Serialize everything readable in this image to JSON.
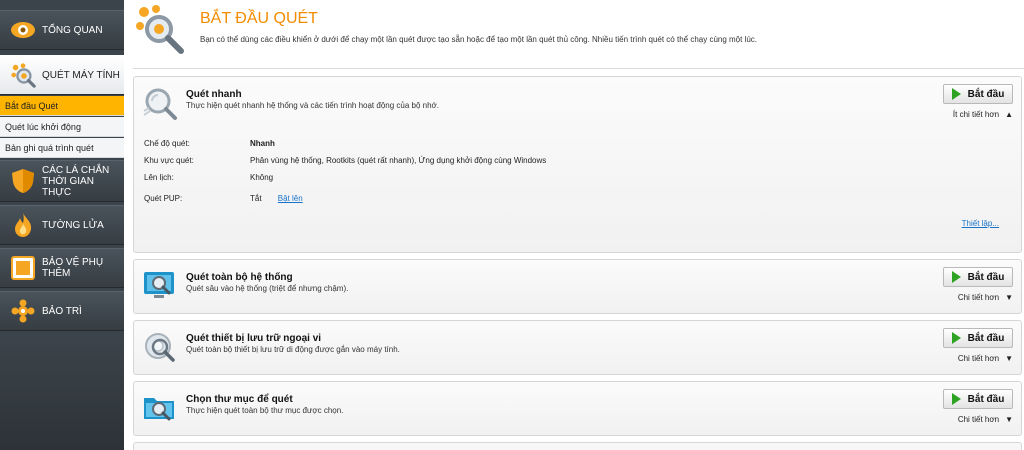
{
  "sidebar": {
    "items": [
      {
        "label": "TỔNG QUAN"
      },
      {
        "label": "QUÉT MÁY TÍNH"
      },
      {
        "label": "CÁC LÁ CHẮN\nTHỜI GIAN THỰC"
      },
      {
        "label": "TƯỜNG LỬA"
      },
      {
        "label": "BẢO VỆ PHỤ\nTHÊM"
      },
      {
        "label": "BẢO TRÌ"
      }
    ],
    "subitems": [
      {
        "label": "Bắt đầu Quét"
      },
      {
        "label": "Quét lúc khởi động"
      },
      {
        "label": "Bản ghi quá trình quét"
      }
    ]
  },
  "header": {
    "title": "BẮT ĐẦU QUÉT",
    "description": "Bạn có thể dùng các điều khiển ở dưới để chạy một lần quét được tạo sẵn hoặc để tạo một lần quét thủ công. Nhiều tiến trình quét có thể chạy cùng một lúc."
  },
  "panels": [
    {
      "title": "Quét nhanh",
      "description": "Thực hiện quét nhanh hệ thống và các tiến trình hoạt động của bộ nhớ.",
      "button": "Bắt đầu",
      "toggle": "Ít chi tiết hơn",
      "toggle_arrow": "▲",
      "details": {
        "mode_label": "Chế độ quét:",
        "mode_value": "Nhanh",
        "area_label": "Khu vực quét:",
        "area_value": "Phân vùng hệ thống, Rootkits (quét rất nhanh), Ứng dụng khởi động cùng Windows",
        "schedule_label": "Lên lịch:",
        "schedule_value": "Không",
        "pup_label": "Quét PUP:",
        "pup_value": "Tắt",
        "pup_link": "Bật lên",
        "settings_link": "Thiết lập..."
      }
    },
    {
      "title": "Quét toàn bộ hệ thống",
      "description": "Quét sâu vào hệ thống (triệt để nhưng chậm).",
      "button": "Bắt đầu",
      "toggle": "Chi tiết hơn",
      "toggle_arrow": "▼"
    },
    {
      "title": "Quét thiết bị lưu trữ ngoại vi",
      "description": "Quét toàn bộ thiết bị lưu trữ di động được gắn vào máy tính.",
      "button": "Bắt đầu",
      "toggle": "Chi tiết hơn",
      "toggle_arrow": "▼"
    },
    {
      "title": "Chọn thư mục để quét",
      "description": "Thực hiện quét toàn bộ thư mục được chọn.",
      "button": "Bắt đầu",
      "toggle": "Chi tiết hơn",
      "toggle_arrow": "▼"
    }
  ],
  "colors": {
    "accent": "#f28c00",
    "active_subitem": "#ffb400",
    "sidebar_bg": "#3c444b",
    "link": "#1a73c9",
    "play": "#2ea323"
  },
  "icons": {
    "overview": "eye-icon",
    "scan": "magnifier-icon",
    "shields": "shield-icon",
    "firewall": "flame-icon",
    "extra": "square-icon",
    "maintenance": "gears-icon"
  }
}
